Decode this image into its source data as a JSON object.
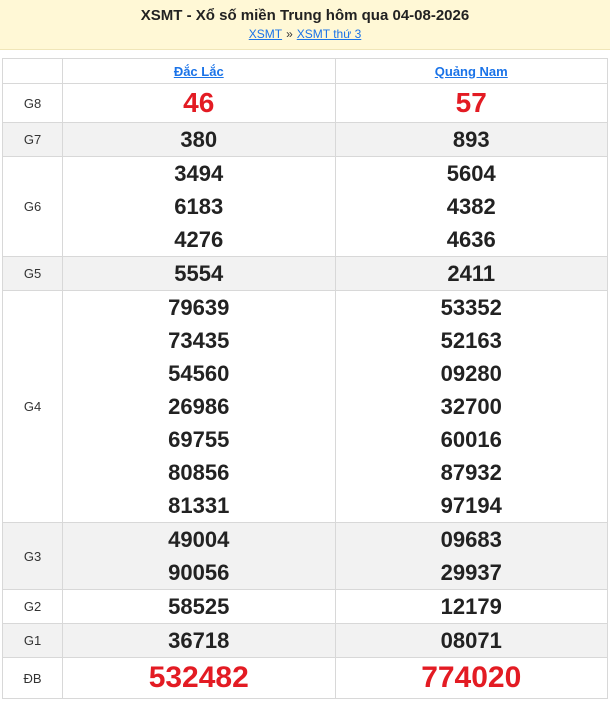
{
  "header": {
    "title": "XSMT - Xổ số miền Trung hôm qua 04-08-2026",
    "crumb_1": "XSMT",
    "crumb_sep": "»",
    "crumb_2": "XSMT thứ 3"
  },
  "provinces": [
    "Đắc Lắc",
    "Quảng Nam"
  ],
  "prizes": [
    {
      "label": "G8",
      "style": "big",
      "values": [
        [
          "46"
        ],
        [
          "57"
        ]
      ]
    },
    {
      "label": "G7",
      "style": "normal",
      "values": [
        [
          "380"
        ],
        [
          "893"
        ]
      ]
    },
    {
      "label": "G6",
      "style": "normal",
      "values": [
        [
          "3494",
          "6183",
          "4276"
        ],
        [
          "5604",
          "4382",
          "4636"
        ]
      ]
    },
    {
      "label": "G5",
      "style": "normal",
      "values": [
        [
          "5554"
        ],
        [
          "2411"
        ]
      ]
    },
    {
      "label": "G4",
      "style": "normal",
      "values": [
        [
          "79639",
          "73435",
          "54560",
          "26986",
          "69755",
          "80856",
          "81331"
        ],
        [
          "53352",
          "52163",
          "09280",
          "32700",
          "60016",
          "87932",
          "97194"
        ]
      ]
    },
    {
      "label": "G3",
      "style": "normal",
      "values": [
        [
          "49004",
          "90056"
        ],
        [
          "09683",
          "29937"
        ]
      ]
    },
    {
      "label": "G2",
      "style": "normal",
      "values": [
        [
          "58525"
        ],
        [
          "12179"
        ]
      ]
    },
    {
      "label": "G1",
      "style": "normal",
      "values": [
        [
          "36718"
        ],
        [
          "08071"
        ]
      ]
    },
    {
      "label": "ĐB",
      "style": "db",
      "values": [
        [
          "532482"
        ],
        [
          "774020"
        ]
      ]
    }
  ],
  "colors": {
    "accent_red": "#e31b23",
    "link_blue": "#1a73e8",
    "header_bg": "#fff8d6"
  }
}
